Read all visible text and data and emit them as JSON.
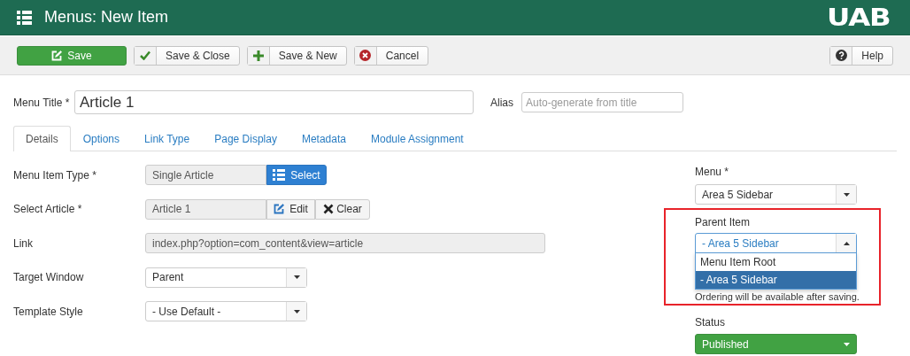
{
  "window": {
    "title": "Menus: New Item",
    "logo": "UAB"
  },
  "toolbar": {
    "buttons": [
      {
        "label": "Save",
        "kind": "primary"
      },
      {
        "label": "Save & Close",
        "kind": "check"
      },
      {
        "label": "Save & New",
        "kind": "plus"
      },
      {
        "label": "Cancel",
        "kind": "cancel"
      }
    ],
    "help": {
      "label": "Help"
    }
  },
  "title_row": {
    "menu_title": {
      "label": "Menu Title *",
      "value": "Article 1"
    },
    "alias": {
      "label": "Alias",
      "placeholder": "Auto-generate from title"
    }
  },
  "tabs": [
    {
      "label": "Details",
      "selected": true
    },
    {
      "label": "Options",
      "selected": false
    },
    {
      "label": "Link Type",
      "selected": false
    },
    {
      "label": "Page Display",
      "selected": false
    },
    {
      "label": "Metadata",
      "selected": false
    },
    {
      "label": "Module Assignment",
      "selected": false
    }
  ],
  "fields": [
    {
      "label": "Menu Item Type *",
      "kind": "picker",
      "value": "Single Article",
      "buttons": [
        {
          "label": "Select",
          "kind": "select"
        }
      ]
    },
    {
      "label": "Select Article *",
      "kind": "picker",
      "value": "Article 1",
      "buttons": [
        {
          "label": "Edit",
          "kind": "edit"
        },
        {
          "label": "Clear",
          "kind": "clear"
        }
      ]
    },
    {
      "label": "Link",
      "kind": "readonly",
      "value": "index.php?option=com_content&view=article"
    },
    {
      "label": "Target Window",
      "kind": "select",
      "value": "Parent"
    },
    {
      "label": "Template Style",
      "kind": "select",
      "value": "- Use Default -"
    }
  ],
  "sidebar": {
    "menu": {
      "label": "Menu *",
      "value": "Area 5 Sidebar"
    },
    "parent_item": {
      "label": "Parent Item",
      "value": "- Area 5 Sidebar",
      "expanded": true,
      "options": [
        {
          "label": "Menu Item Root",
          "selected": false
        },
        {
          "label": "- Area 5 Sidebar",
          "selected": true
        }
      ]
    },
    "ordering_note": "Ordering will be available after saving.",
    "status": {
      "label": "Status",
      "value": "Published"
    }
  }
}
